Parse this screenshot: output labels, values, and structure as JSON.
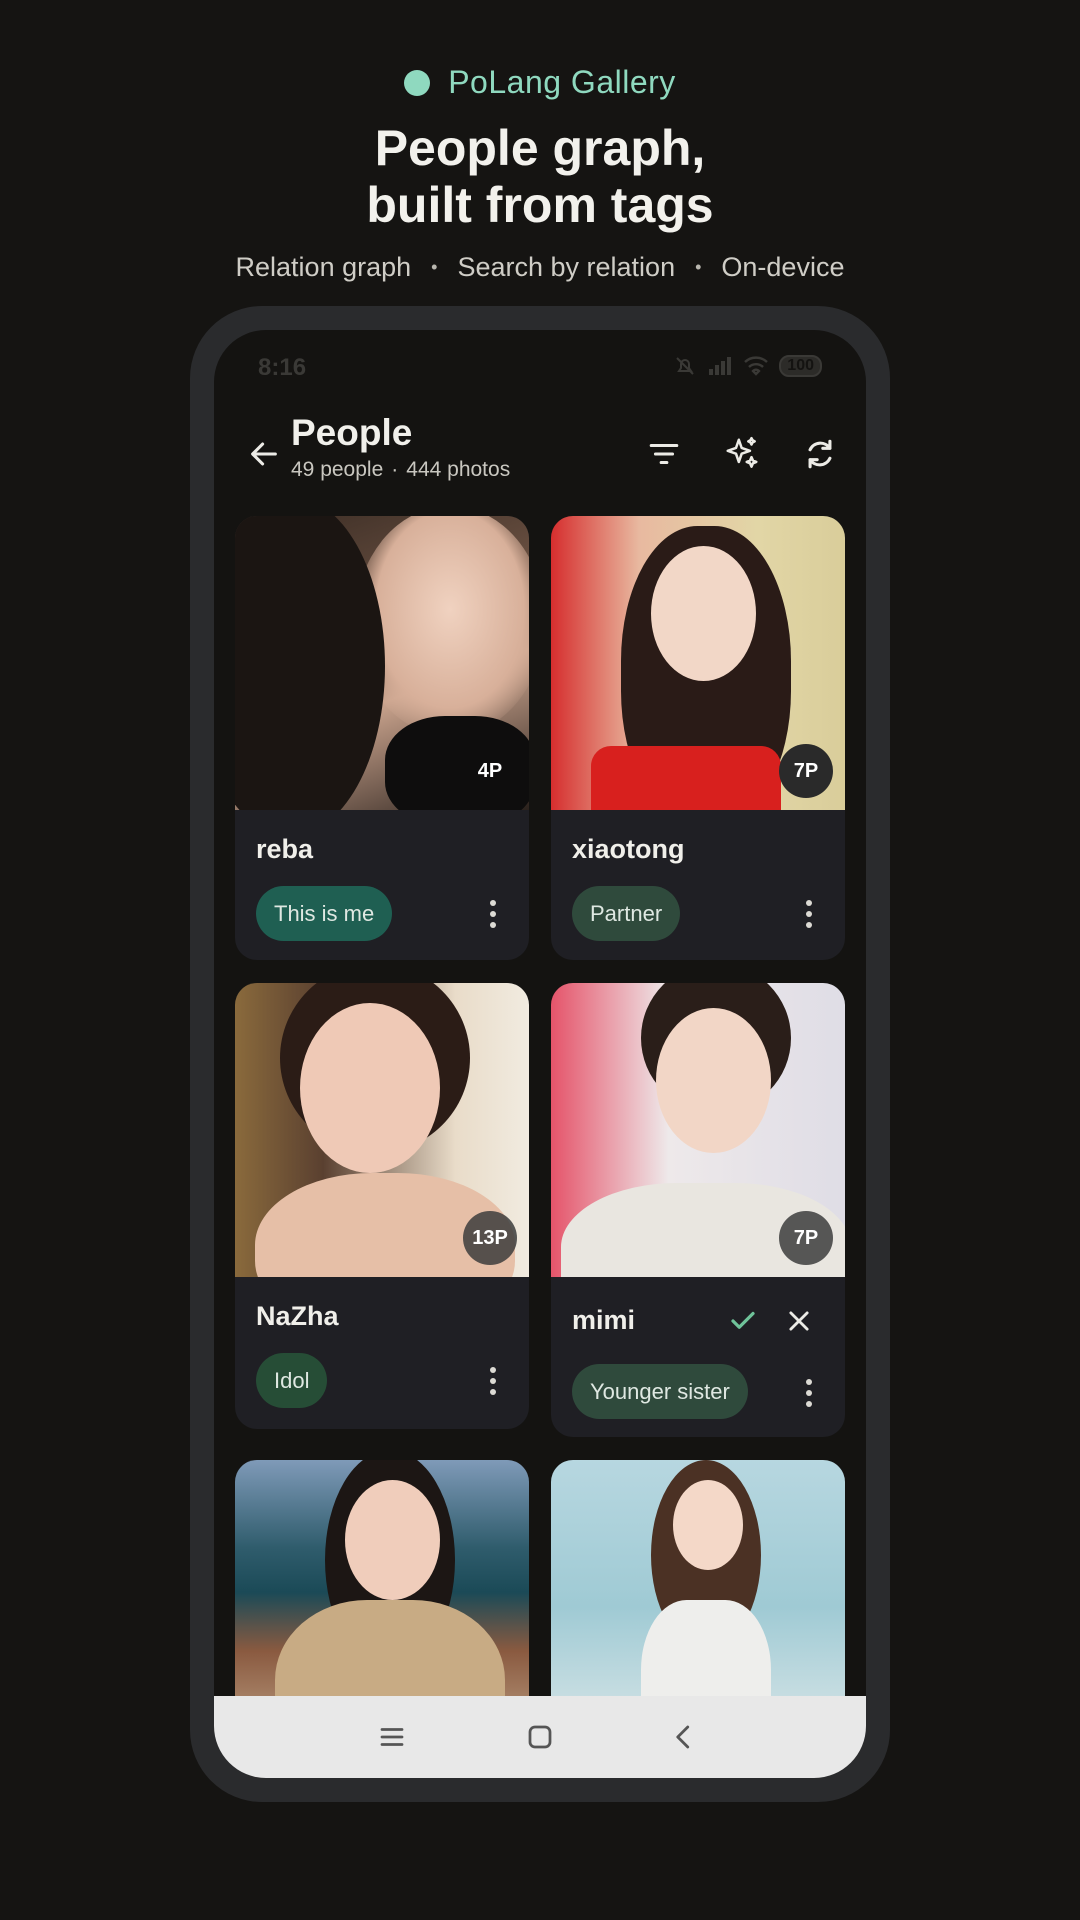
{
  "promo": {
    "brand_name": "PoLang Gallery",
    "headline_line1": "People graph,",
    "headline_line2": "built from tags",
    "features": [
      "Relation graph",
      "Search by relation",
      "On-device"
    ],
    "separator": "•"
  },
  "status_bar": {
    "time": "8:16",
    "battery": "100"
  },
  "appbar": {
    "title": "People",
    "people_count": "49 people",
    "photo_count": "444 photos",
    "separator": "·",
    "icons": [
      "back-arrow-icon",
      "filter-icon",
      "sparkle-icon",
      "refresh-icon"
    ]
  },
  "people": [
    {
      "name": "reba",
      "count": "4P",
      "tag": "This is me",
      "tag_color": "#1f5f52"
    },
    {
      "name": "xiaotong",
      "count": "7P",
      "tag": "Partner",
      "tag_color": "#2f4a3c"
    },
    {
      "name": "NaZha",
      "count": "13P",
      "tag": "Idol",
      "tag_color": "#264d36"
    },
    {
      "name": "mimi",
      "count": "7P",
      "tag": "Younger sister",
      "tag_color": "#2f4a3c",
      "editing": true
    },
    {
      "name": "",
      "count": "",
      "tag": ""
    },
    {
      "name": "",
      "count": "",
      "tag": ""
    }
  ],
  "colors": {
    "accent": "#8fd9bf",
    "background": "#151412",
    "card": "#1f1f24",
    "confirm": "#6fc39a"
  },
  "navbar": {
    "icons": [
      "menu-icon",
      "home-icon",
      "back-icon"
    ]
  }
}
